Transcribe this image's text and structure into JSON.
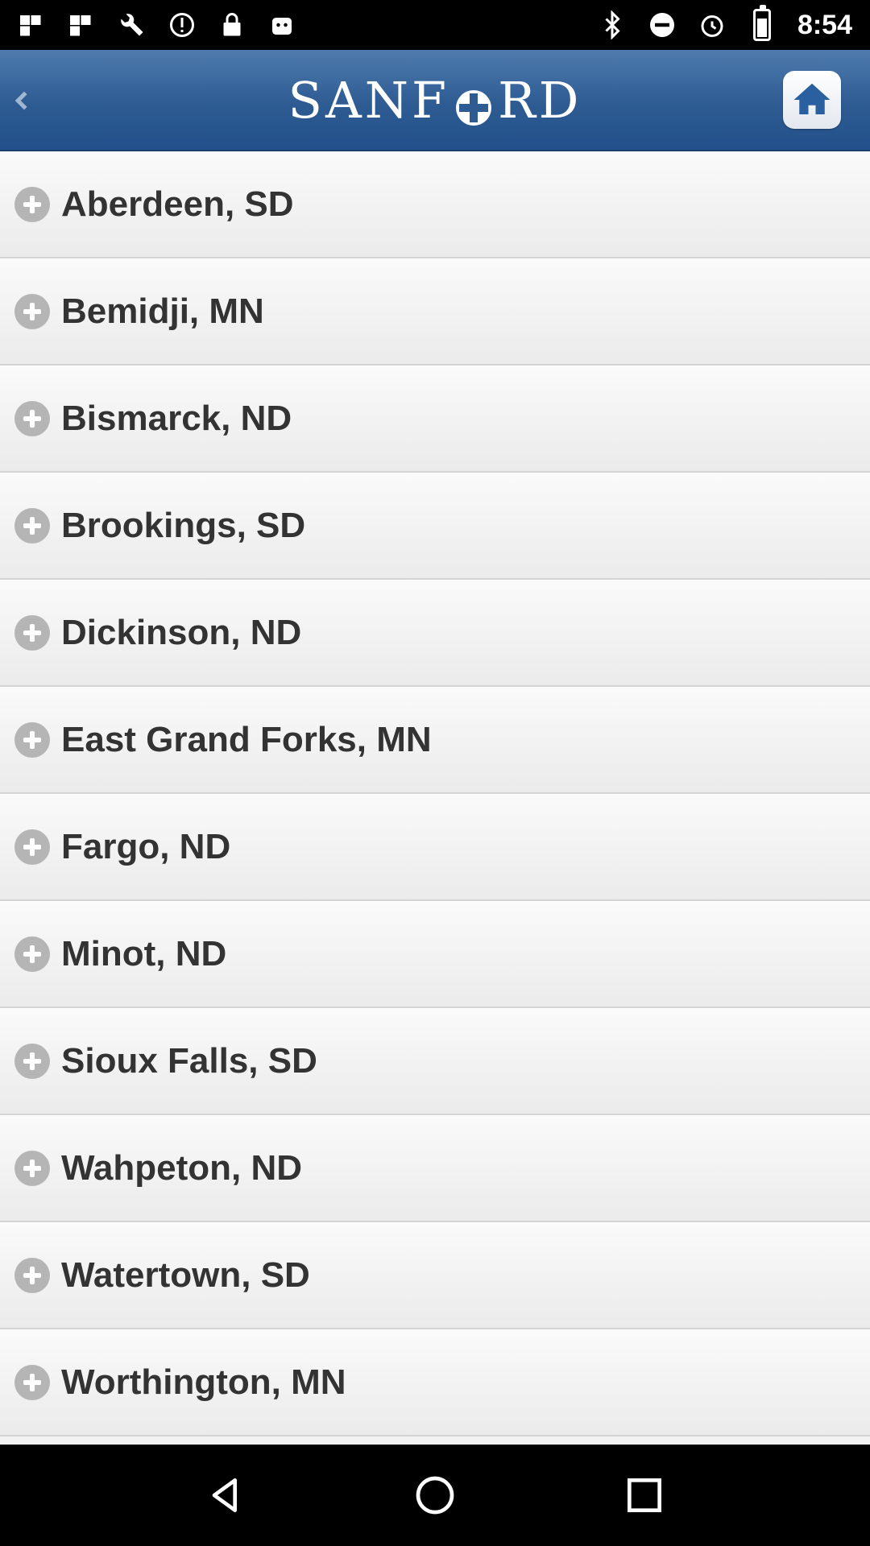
{
  "status_bar": {
    "time": "8:54",
    "battery_level": 0.8
  },
  "header": {
    "logo_left": "SANF",
    "logo_right": "RD",
    "back_icon": "chevron-left-icon",
    "home_icon": "home-icon"
  },
  "locations": [
    {
      "label": "Aberdeen, SD"
    },
    {
      "label": "Bemidji, MN"
    },
    {
      "label": "Bismarck, ND"
    },
    {
      "label": "Brookings, SD"
    },
    {
      "label": "Dickinson, ND"
    },
    {
      "label": "East Grand Forks, MN"
    },
    {
      "label": "Fargo, ND"
    },
    {
      "label": "Minot, ND"
    },
    {
      "label": "Sioux Falls, SD"
    },
    {
      "label": "Wahpeton, ND"
    },
    {
      "label": "Watertown, SD"
    },
    {
      "label": "Worthington, MN"
    }
  ],
  "colors": {
    "header": "#2d5b92",
    "home_icon": "#2a5fa0",
    "list_text": "#333333"
  }
}
